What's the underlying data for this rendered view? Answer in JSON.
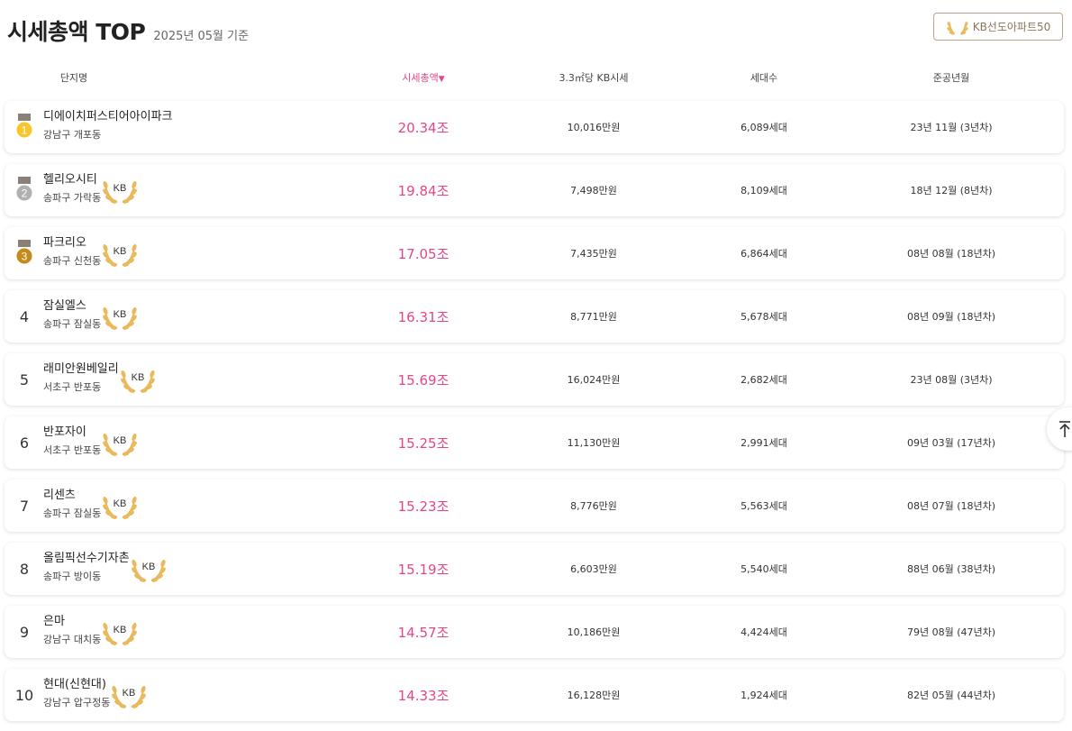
{
  "header": {
    "title": "시세총액 TOP",
    "subtitle": "2025년 05월 기준",
    "kb50_label": "KB선도아파트50"
  },
  "columns": {
    "name": "단지명",
    "total_value": "시세총액",
    "total_value_sort_arrow": "▼",
    "price_per_area": "3.3㎡당 KB시세",
    "households": "세대수",
    "completed": "준공년월"
  },
  "kb_badge_text": "KB",
  "colors": {
    "accent": "#e4468b",
    "gold": "#f6c72d",
    "silver": "#b0b0b0",
    "bronze": "#c58a1a",
    "laurel": "#e9b95c"
  },
  "rows": [
    {
      "rank": "1",
      "medal": "gold",
      "name": "디에이치퍼스티어아이파크",
      "location": "강남구 개포동",
      "kb": false,
      "total_value": "20.34조",
      "price_per_area": "10,016만원",
      "households": "6,089세대",
      "completed": "23년 11월 (3년차)"
    },
    {
      "rank": "2",
      "medal": "silver",
      "name": "헬리오시티",
      "location": "송파구 가락동",
      "kb": true,
      "total_value": "19.84조",
      "price_per_area": "7,498만원",
      "households": "8,109세대",
      "completed": "18년 12월 (8년차)"
    },
    {
      "rank": "3",
      "medal": "bronze",
      "name": "파크리오",
      "location": "송파구 신천동",
      "kb": true,
      "total_value": "17.05조",
      "price_per_area": "7,435만원",
      "households": "6,864세대",
      "completed": "08년 08월 (18년차)"
    },
    {
      "rank": "4",
      "medal": "",
      "name": "잠실엘스",
      "location": "송파구 잠실동",
      "kb": true,
      "total_value": "16.31조",
      "price_per_area": "8,771만원",
      "households": "5,678세대",
      "completed": "08년 09월 (18년차)"
    },
    {
      "rank": "5",
      "medal": "",
      "name": "래미안원베일리",
      "location": "서초구 반포동",
      "kb": true,
      "total_value": "15.69조",
      "price_per_area": "16,024만원",
      "households": "2,682세대",
      "completed": "23년 08월 (3년차)"
    },
    {
      "rank": "6",
      "medal": "",
      "name": "반포자이",
      "location": "서초구 반포동",
      "kb": true,
      "total_value": "15.25조",
      "price_per_area": "11,130만원",
      "households": "2,991세대",
      "completed": "09년 03월 (17년차)"
    },
    {
      "rank": "7",
      "medal": "",
      "name": "리센츠",
      "location": "송파구 잠실동",
      "kb": true,
      "total_value": "15.23조",
      "price_per_area": "8,776만원",
      "households": "5,563세대",
      "completed": "08년 07월 (18년차)"
    },
    {
      "rank": "8",
      "medal": "",
      "name": "올림픽선수기자촌",
      "location": "송파구 방이동",
      "kb": true,
      "total_value": "15.19조",
      "price_per_area": "6,603만원",
      "households": "5,540세대",
      "completed": "88년 06월 (38년차)"
    },
    {
      "rank": "9",
      "medal": "",
      "name": "은마",
      "location": "강남구 대치동",
      "kb": true,
      "total_value": "14.57조",
      "price_per_area": "10,186만원",
      "households": "4,424세대",
      "completed": "79년 08월 (47년차)"
    },
    {
      "rank": "10",
      "medal": "",
      "name": "현대(신현대)",
      "location": "강남구 압구정동",
      "kb": true,
      "total_value": "14.33조",
      "price_per_area": "16,128만원",
      "households": "1,924세대",
      "completed": "82년 05월 (44년차)"
    }
  ]
}
